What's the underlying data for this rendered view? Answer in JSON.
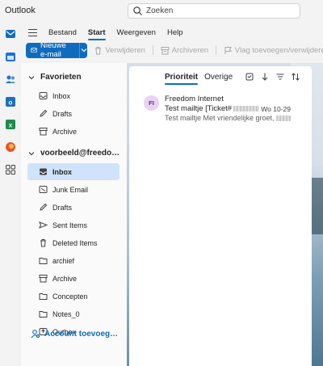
{
  "app": {
    "title": "Outlook"
  },
  "search": {
    "placeholder": "Zoeken"
  },
  "ribbon": {
    "tabs": [
      {
        "label": "Bestand"
      },
      {
        "label": "Start"
      },
      {
        "label": "Weergeven"
      },
      {
        "label": "Help"
      }
    ],
    "new_mail_label": "Nieuwe e-mail",
    "delete_label": "Verwijderen",
    "archive_label": "Archiveren",
    "flag_label": "Vlag toevoegen/verwijderen"
  },
  "favorites": {
    "title": "Favorieten",
    "items": [
      {
        "label": "Inbox"
      },
      {
        "label": "Drafts"
      },
      {
        "label": "Archive"
      }
    ]
  },
  "account": {
    "title": "voorbeeld@freedo…",
    "folders": [
      {
        "label": "Inbox"
      },
      {
        "label": "Junk Email"
      },
      {
        "label": "Drafts"
      },
      {
        "label": "Sent Items"
      },
      {
        "label": "Deleted Items"
      },
      {
        "label": "archief"
      },
      {
        "label": "Archive"
      },
      {
        "label": "Concepten"
      },
      {
        "label": "Notes_0"
      },
      {
        "label": "Outbox"
      }
    ],
    "add_account_label": "Account toevoeg…"
  },
  "message_list": {
    "tab_focused": "Prioriteit",
    "tab_other": "Overige",
    "messages": [
      {
        "initials": "FI",
        "from": "Freedom Internet",
        "subject": "Test mailtje [Ticket#",
        "date": "Wo 10-29",
        "preview": "Test mailtje Met vriendelijke groet,"
      }
    ]
  },
  "colors": {
    "accent": "#0f6cbd",
    "selected": "#cfe4fa"
  }
}
